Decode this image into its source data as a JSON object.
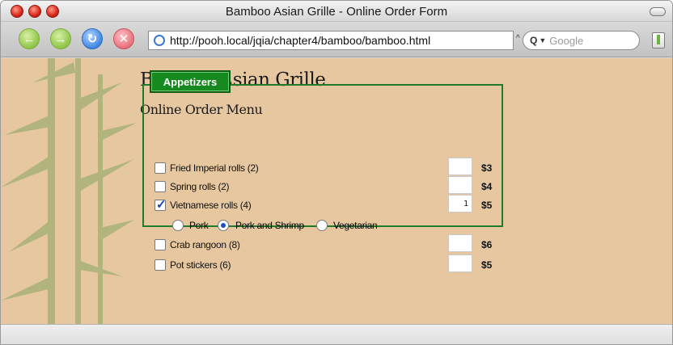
{
  "window": {
    "title": "Bamboo Asian Grille - Online Order Form"
  },
  "toolbar": {
    "url": "http://pooh.local/jqia/chapter4/bamboo/bamboo.html",
    "search_placeholder": "Google"
  },
  "page": {
    "title": "Bamboo Asian Grille",
    "subtitle": "Online Order Menu",
    "section_legend": "Appetizers",
    "items": [
      {
        "label": "Fried Imperial rolls (2)",
        "quantity": "",
        "price": "$3",
        "checked": false
      },
      {
        "label": "Spring rolls (2)",
        "quantity": "",
        "price": "$4",
        "checked": false
      },
      {
        "label": "Vietnamese rolls (4)",
        "quantity": "1",
        "price": "$5",
        "checked": true
      },
      {
        "label": "Crab rangoon (8)",
        "quantity": "",
        "price": "$6",
        "checked": false
      },
      {
        "label": "Pot stickers (6)",
        "quantity": "",
        "price": "$5",
        "checked": false
      }
    ],
    "options": [
      {
        "label": "Pork",
        "selected": false
      },
      {
        "label": "Pork and Shrimp",
        "selected": true
      },
      {
        "label": "Vegetarian",
        "selected": false
      }
    ]
  },
  "colors": {
    "page_background": "#e7c79f",
    "legend_green": "#168a1f",
    "fieldset_border": "#1f7a2a"
  }
}
